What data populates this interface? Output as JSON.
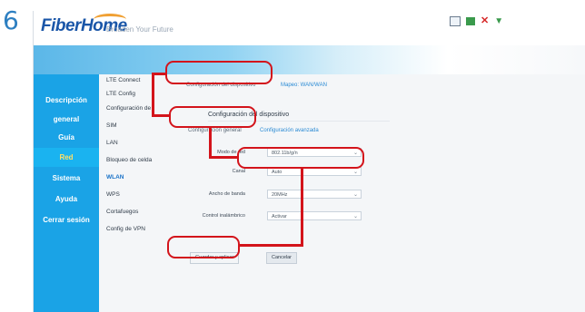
{
  "step": "6",
  "header": {
    "logo": "FiberHome",
    "tagline": "Broaden Your Future",
    "icons": [
      "mail-icon",
      "screen-icon",
      "close-icon",
      "signal-icon"
    ]
  },
  "sidebar": {
    "items": [
      {
        "label": "Descripción",
        "active": false
      },
      {
        "label": "general",
        "active": false
      },
      {
        "label": "Guía",
        "active": false
      },
      {
        "label": "Red",
        "active": true
      },
      {
        "label": "Sistema",
        "active": false
      },
      {
        "label": "Ayuda",
        "active": false
      },
      {
        "label": "Cerrar sesión",
        "active": false
      }
    ]
  },
  "subnav": {
    "items": [
      {
        "label": "LTE Connect",
        "active": false
      },
      {
        "label": "LTE Config",
        "active": false
      },
      {
        "label": "Configuración de",
        "active": false
      },
      {
        "label": "SIM",
        "active": false
      },
      {
        "label": "LAN",
        "active": false
      },
      {
        "label": "Bloqueo de celda",
        "active": false
      },
      {
        "label": "WLAN",
        "active": true
      },
      {
        "label": "WPS",
        "active": false
      },
      {
        "label": "Cortafuegos",
        "active": false
      },
      {
        "label": "Config de VPN",
        "active": false
      }
    ]
  },
  "content": {
    "top_tabs": [
      "Configuración del dispositivo",
      "Mapeo: WAN/WAN"
    ],
    "section_title": "Configuración del dispositivo",
    "sub_tabs": [
      "Configuración general",
      "Configuración avanzada"
    ],
    "fields": [
      {
        "label": "Modo de red",
        "value": "802.11b/g/n"
      },
      {
        "label": "Canal",
        "value": "Auto"
      },
      {
        "label": "Ancho de banda",
        "value": "20MHz"
      },
      {
        "label": "Control inalámbrico",
        "value": "Activar"
      }
    ],
    "save_button": "Guardar y aplicar",
    "cancel_button": "Cancelar"
  },
  "colors": {
    "sidebar": "#1aa3e6",
    "accent": "#2a8ad4",
    "callout": "#d3141b",
    "active_nav": "#ffe066"
  }
}
